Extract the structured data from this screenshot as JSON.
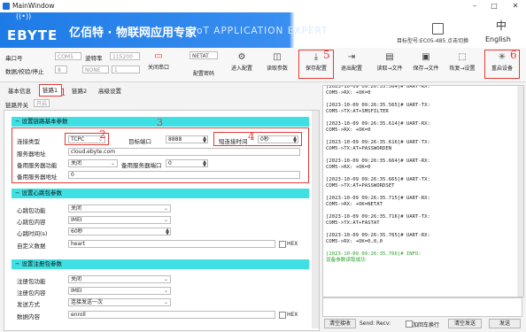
{
  "window": {
    "title": "MainWindow",
    "minimize": "–",
    "maximize": "□",
    "close": "✕"
  },
  "banner": {
    "logo": "EBYTE",
    "title_cn": "亿佰特 · 物联网应用专家",
    "title_en": "IoT APPLICATION EXPERT",
    "module_label": "目标型号:EC05-485 点击切换",
    "language_label": "English"
  },
  "toolbar": {
    "serial_label": "串口号",
    "serial_value": "COM5",
    "baud_label": "波特率",
    "baud_value": "115200",
    "data_label": "数据/校验/停止",
    "data_value": "8",
    "parity_value": "NONE",
    "stop_value": "1",
    "close_port": "关闭串口",
    "password_value": "NETAT",
    "config_password": "配置密码",
    "enter_config": "进入配置",
    "read_params": "读取参数",
    "save_config": "保存配置",
    "exit_config": "退出配置",
    "read_file": "读取→文件",
    "save_file": "保存→文件",
    "restore_settings": "恢复→设置",
    "restart_device": "重启设备",
    "markers": {
      "n1": "1",
      "n2": "2",
      "n3": "3",
      "n4": "4",
      "n5": "5",
      "n6": "6"
    }
  },
  "tabs": {
    "basic": "基本信息",
    "link1": "链路1",
    "link2": "链路2",
    "advanced": "高级设置",
    "link_switch": "链路开关",
    "link_switch_value": "开启"
  },
  "sections": {
    "basic": {
      "header": "设置链路基本参数",
      "conn_type_label": "连接类型",
      "conn_type_value": "TCPC",
      "target_port_label": "目标端口",
      "target_port_value": "8888",
      "short_conn_label": "短连接时间",
      "short_conn_value": "0秒",
      "server_addr_label": "服务器地址",
      "server_addr_value": "cloud.ebyte.com",
      "backup_func_label": "备用服务器功能",
      "backup_func_value": "关闭",
      "backup_port_label": "备用服务器端口",
      "backup_port_value": "0",
      "backup_addr_label": "备用服务器地址",
      "backup_addr_value": "0"
    },
    "heartbeat": {
      "header": "设置心跳包参数",
      "func_label": "心跳包功能",
      "func_value": "关闭",
      "content_label": "心跳包内容",
      "content_value": "IMEI",
      "time_label": "心跳时间(s)",
      "time_value": "60秒",
      "custom_label": "自定义数据",
      "custom_value": "heart",
      "hex": "HEX"
    },
    "register": {
      "header": "设置注册包参数",
      "func_label": "注册包功能",
      "func_value": "关闭",
      "content_label": "注册包内容",
      "content_value": "IMEI",
      "mode_label": "发送方式",
      "mode_value": "连接发送一次",
      "data_label": "数据内容",
      "data_value": "enroll",
      "hex": "HEX"
    }
  },
  "log": [
    {
      "text": "[2023-10-09 09:26:35.564]# UART-RX:",
      "green": false
    },
    {
      "text": "COM5->RX: +OK=0",
      "green": false
    },
    {
      "text": "",
      "green": false
    },
    {
      "text": "[2023-10-09 09:26:35.565]# UART-TX:",
      "green": false
    },
    {
      "text": "COM5->TX:AT+SMSFILTER",
      "green": false
    },
    {
      "text": "",
      "green": false
    },
    {
      "text": "[2023-10-09 09:26:35.614]# UART-RX:",
      "green": false
    },
    {
      "text": "COM5->RX: +OK=0",
      "green": false
    },
    {
      "text": "",
      "green": false
    },
    {
      "text": "[2023-10-09 09:26:35.616]# UART-TX:",
      "green": false
    },
    {
      "text": "COM5->TX:AT+PASSWORDEN",
      "green": false
    },
    {
      "text": "",
      "green": false
    },
    {
      "text": "[2023-10-09 09:26:35.664]# UART-RX:",
      "green": false
    },
    {
      "text": "COM5->RX: +OK=0",
      "green": false
    },
    {
      "text": "",
      "green": false
    },
    {
      "text": "[2023-10-09 09:26:35.665]# UART-TX:",
      "green": false
    },
    {
      "text": "COM5->TX:AT+PASSWORDSET",
      "green": false
    },
    {
      "text": "",
      "green": false
    },
    {
      "text": "[2023-10-09 09:26:35.715]# UART-RX:",
      "green": false
    },
    {
      "text": "COM5->RX: +OK=NETAT",
      "green": false
    },
    {
      "text": "",
      "green": false
    },
    {
      "text": "[2023-10-09 09:26:35.716]# UART-TX:",
      "green": false
    },
    {
      "text": "COM5->TX:AT+FASTAT",
      "green": false
    },
    {
      "text": "",
      "green": false
    },
    {
      "text": "[2023-10-09 09:26:35.765]# UART-RX:",
      "green": false
    },
    {
      "text": "COM5->RX: +OK=0,0,0",
      "green": false
    },
    {
      "text": "",
      "green": false
    },
    {
      "text": "[2023-10-09 09:26:35.766]# INFO:",
      "green": true
    },
    {
      "text": "设备参数读取成功",
      "green": true
    }
  ],
  "bottom": {
    "clear_recv": "清空接收",
    "send_recv": "Send: Recv:",
    "add_crlf": "加回车换行",
    "clear_send": "清空发送",
    "send": "发送"
  },
  "colors": {
    "accent": "#1e7be6",
    "section": "#3ee0e3",
    "highlight": "#e53935",
    "log_green": "#2aa22a"
  }
}
